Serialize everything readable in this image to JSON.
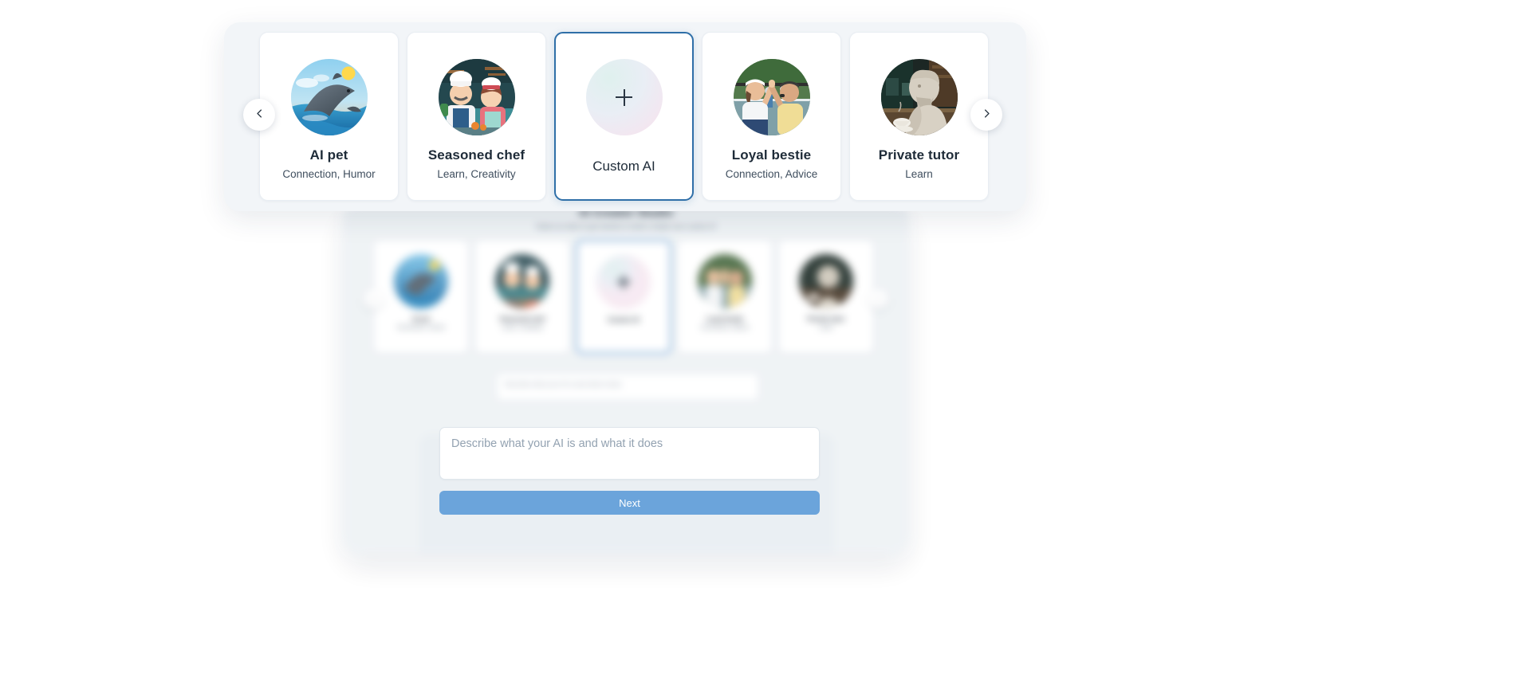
{
  "panel": {
    "prev_label": "chevron-left",
    "next_label": "chevron-right"
  },
  "personas": [
    {
      "name": "AI pet",
      "tags": "Connection, Humor",
      "icon": "dolphin-avatar",
      "selected": false
    },
    {
      "name": "Seasoned chef",
      "tags": "Learn, Creativity",
      "icon": "chefs-avatar",
      "selected": false
    },
    {
      "name": "Custom AI",
      "tags": "",
      "icon": "plus-orb-icon",
      "selected": true
    },
    {
      "name": "Loyal bestie",
      "tags": "Connection, Advice",
      "icon": "highfive-avatar",
      "selected": false
    },
    {
      "name": "Private tutor",
      "tags": "Learn",
      "icon": "philosopher-avatar",
      "selected": false
    }
  ],
  "background": {
    "title": "AI Creator Studio",
    "subtitle": "Select an idea to get started or build a totally new custom AI",
    "input_placeholder": "Describe what your AI is and what it does"
  },
  "form": {
    "description_value": "",
    "description_placeholder": "Describe what your AI is and what it does",
    "next_label": "Next"
  },
  "colors": {
    "accent": "#2f6fa8",
    "button": "#6ba4db",
    "panel_bg": "#f2f5f8",
    "card_bg": "#ffffff",
    "text": "#1e2b38",
    "muted": "#3f4e5e"
  }
}
